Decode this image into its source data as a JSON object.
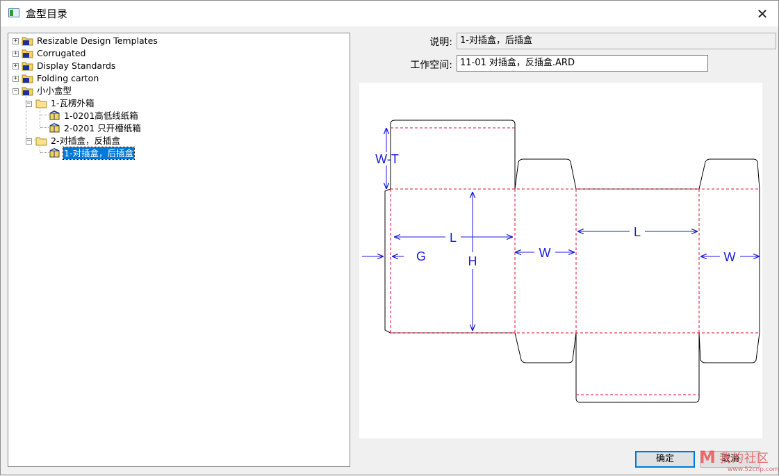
{
  "window": {
    "title": "盒型目录",
    "close_glyph": "✕"
  },
  "tree": {
    "nodes": [
      {
        "label": "Resizable Design Templates",
        "expander": "+"
      },
      {
        "label": "Corrugated",
        "expander": "+"
      },
      {
        "label": "Display Standards",
        "expander": "+"
      },
      {
        "label": "Folding carton",
        "expander": "+"
      },
      {
        "label": "小小盒型",
        "expander": "−"
      },
      {
        "label": "1-瓦楞外箱",
        "expander": "−"
      },
      {
        "label": "1-0201高低线纸箱"
      },
      {
        "label": "2-0201 只开槽纸箱"
      },
      {
        "label": "2-对插盒，反插盒",
        "expander": "−"
      },
      {
        "label": "1-对插盒，后插盒",
        "selected": true
      }
    ]
  },
  "fields": {
    "description_label": "说明:",
    "description_value": "1-对插盒，后插盒",
    "workspace_label": "工作空间:",
    "workspace_value": "11-01 对插盒，反插盒.ARD"
  },
  "preview": {
    "dimension_labels": {
      "wt": "W-T",
      "l_left": "L",
      "g": "G",
      "h": "H",
      "w_mid": "W",
      "l_right": "L",
      "w_right": "W"
    },
    "cut_color": "#000000",
    "fold_color": "#e0102a",
    "dim_color": "#1a1ae0"
  },
  "buttons": {
    "ok_label": "确定",
    "cancel_label": "取消"
  },
  "watermark": {
    "text": "我的社区",
    "url": "www.52cnp.com"
  }
}
